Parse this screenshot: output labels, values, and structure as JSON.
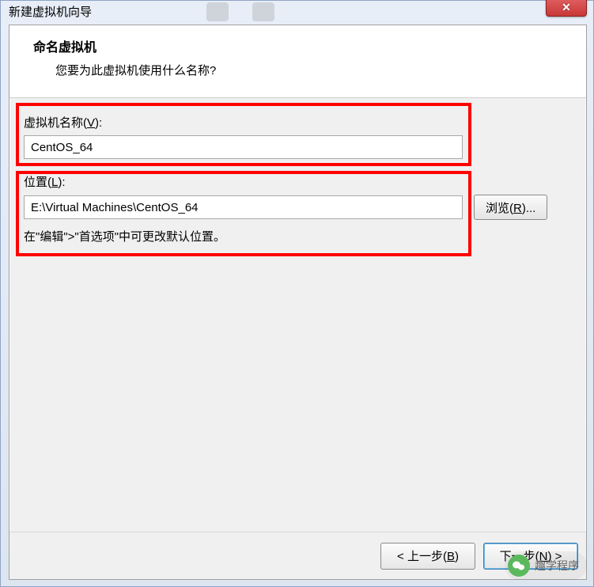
{
  "window": {
    "title": "新建虚拟机向导"
  },
  "header": {
    "title": "命名虚拟机",
    "subtitle": "您要为此虚拟机使用什么名称?"
  },
  "fields": {
    "vmname": {
      "label_pre": "虚拟机名称(",
      "label_key": "V",
      "label_post": "):",
      "value": "CentOS_64"
    },
    "location": {
      "label_pre": "位置(",
      "label_key": "L",
      "label_post": "):",
      "value": "E:\\Virtual Machines\\CentOS_64",
      "browse_pre": "浏览(",
      "browse_key": "R",
      "browse_post": ")..."
    },
    "hint": "在\"编辑\">\"首选项\"中可更改默认位置。"
  },
  "footer": {
    "back_pre": "< 上一步(",
    "back_key": "B",
    "back_post": ")",
    "next_pre": "下一步(",
    "next_key": "N",
    "next_post": ") >"
  },
  "watermark": {
    "text": "趣学程序"
  }
}
